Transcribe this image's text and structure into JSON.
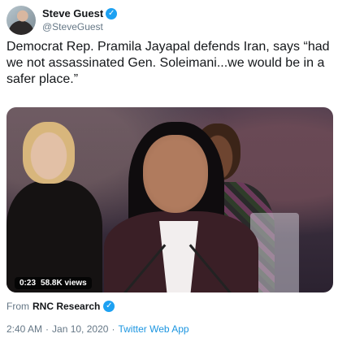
{
  "tweet": {
    "author": {
      "display_name": "Steve Guest",
      "handle": "@SteveGuest",
      "verified_icon": "✓"
    },
    "text": "Democrat Rep. Pramila Jayapal defends Iran, says “had we not assassinated Gen. Soleimani...we would be in a safer place.”",
    "media": {
      "duration": "0:23",
      "views": "58.8K views"
    },
    "source": {
      "prefix": "From",
      "name": "RNC Research",
      "verified_icon": "✓"
    },
    "meta": {
      "time": "2:40 AM",
      "separator1": "·",
      "date": "Jan 10, 2020",
      "separator2": "·",
      "client": "Twitter Web App"
    }
  },
  "colors": {
    "text": "#14171a",
    "secondary": "#657786",
    "accent": "#1b95e0",
    "verified": "#1da1f2"
  },
  "icons": {
    "verified": "verified-badge-icon"
  }
}
